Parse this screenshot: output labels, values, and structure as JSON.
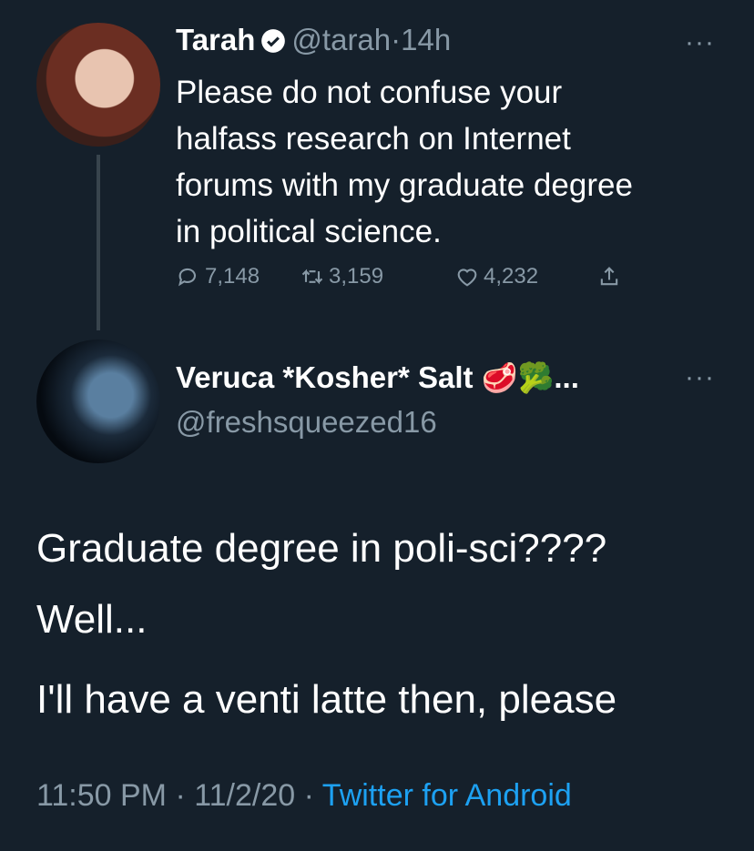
{
  "tweet": {
    "name": "Tarah",
    "handle": "@tarah",
    "separator": "·",
    "time": "14h",
    "text_lines": [
      "Please do not confuse your",
      "halfass research on Internet",
      "forums with my graduate degree",
      "in political science."
    ],
    "replies": "7,148",
    "retweets": "3,159",
    "likes": "4,232",
    "more": "···"
  },
  "reply": {
    "name": "Veruca *Kosher* Salt",
    "emoji": "🥩🥦",
    "ellipsis": "...",
    "handle": "@freshsqueezed16",
    "more": "···",
    "text_lines": [
      "Graduate degree in poli-sci????",
      "Well...",
      "I'll have a venti latte then, please"
    ],
    "time": "11:50 PM",
    "date": "11/2/20",
    "sep": "·",
    "source": "Twitter for Android"
  },
  "colors": {
    "background": "#15202b",
    "muted": "#8899a6",
    "link": "#1da1f2"
  },
  "icons": [
    "verified-icon",
    "reply-icon",
    "retweet-icon",
    "like-icon",
    "share-icon",
    "more-icon"
  ]
}
